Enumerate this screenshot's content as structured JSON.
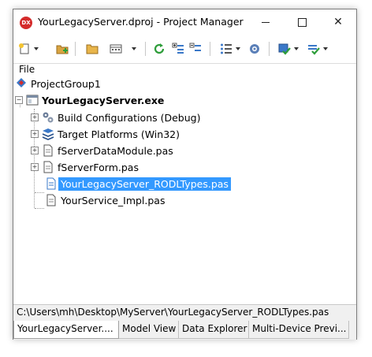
{
  "window": {
    "title": "YourLegacyServer.dproj - Project Manager",
    "app_icon_text": "DX"
  },
  "toolbar": {
    "buttons": [
      {
        "icon": "new-item-icon",
        "dropdown": true
      },
      {
        "icon": "add-file-icon",
        "dropdown": false
      },
      {
        "icon": "open-folder-icon",
        "dropdown": false
      },
      {
        "icon": "view-grid-icon",
        "dropdown": true
      },
      {
        "icon": "refresh-icon",
        "dropdown": false
      },
      {
        "icon": "expand-tree-icon",
        "dropdown": false
      },
      {
        "icon": "collapse-tree-icon",
        "dropdown": false
      },
      {
        "icon": "list-view-icon",
        "dropdown": true
      },
      {
        "icon": "dependencies-icon",
        "dropdown": false
      },
      {
        "icon": "build-icon",
        "dropdown": true
      },
      {
        "icon": "build-all-icon",
        "dropdown": true
      }
    ]
  },
  "file_label": "File",
  "tree": {
    "group": "ProjectGroup1",
    "project": "YourLegacyServer.exe",
    "items": [
      {
        "label": "Build Configurations (Debug)",
        "icon": "gears-icon"
      },
      {
        "label": "Target Platforms (Win32)",
        "icon": "platforms-icon"
      },
      {
        "label": "fServerDataModule.pas",
        "icon": "pas-file-icon"
      },
      {
        "label": "fServerForm.pas",
        "icon": "pas-file-icon"
      },
      {
        "label": "YourLegacyServer_RODLTypes.pas",
        "icon": "pas-file-icon",
        "selected": true
      },
      {
        "label": "YourService_Impl.pas",
        "icon": "pas-file-icon"
      }
    ]
  },
  "status_path": "C:\\Users\\mh\\Desktop\\MyServer\\YourLegacyServer_RODLTypes.pas",
  "tabs": [
    {
      "label": "YourLegacyServer....",
      "active": true
    },
    {
      "label": "Model View",
      "active": false
    },
    {
      "label": "Data Explorer",
      "active": false
    },
    {
      "label": "Multi-Device Previ...",
      "active": false
    }
  ],
  "colors": {
    "selection": "#3399ff",
    "app_icon": "#d42b2b"
  }
}
